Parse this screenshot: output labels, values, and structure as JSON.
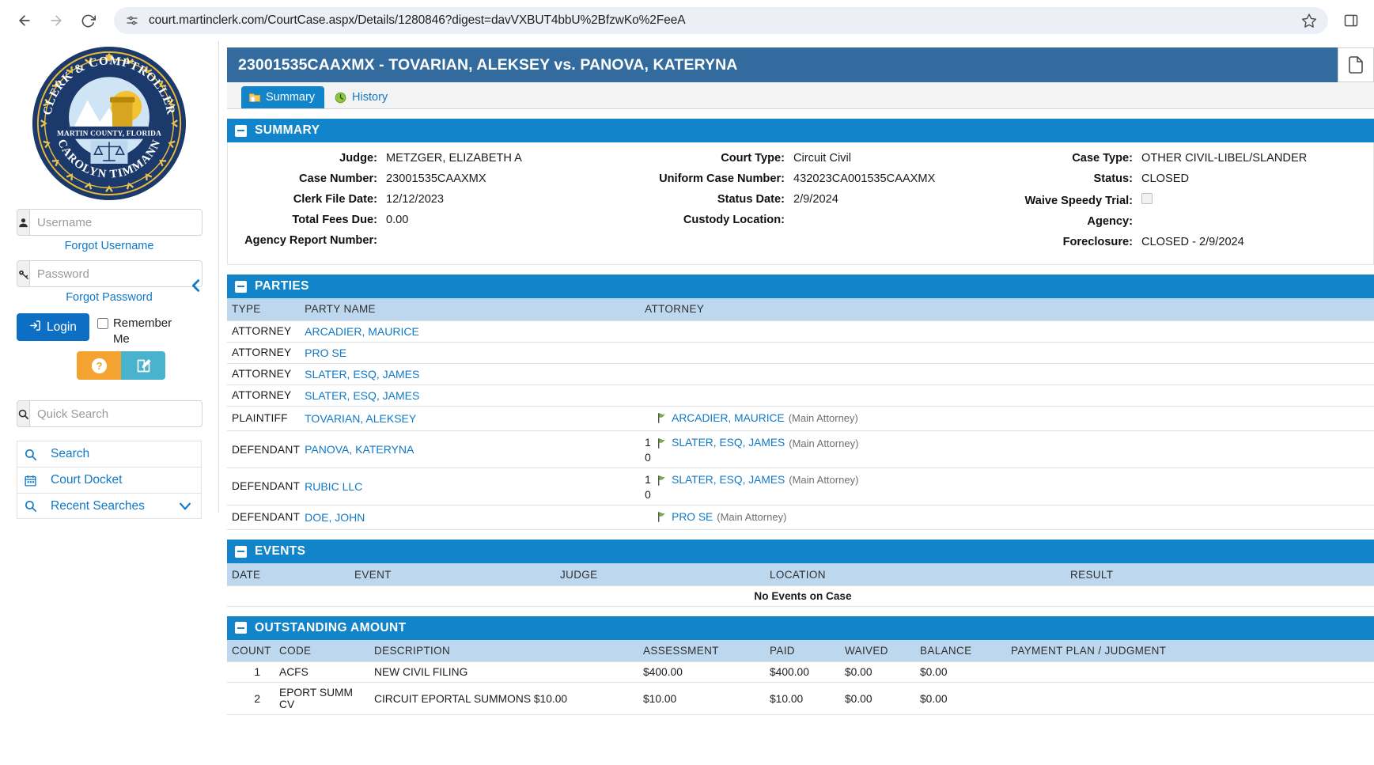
{
  "browser": {
    "url": "court.martinclerk.com/CourtCase.aspx/Details/1280846?digest=davVXBUT4bbU%2BfzwKo%2FeeA",
    "back_label": "Back",
    "forward_label": "Forward",
    "reload_label": "Reload",
    "bookmark_label": "Bookmark this tab",
    "sidepanel_label": "Side panel"
  },
  "sidebar": {
    "seal": {
      "top_text": "CLERK & COMPTROLLER",
      "middle_text": "MARTIN COUNTY, FLORIDA",
      "bottom_text": "CAROLYN TIMMANN"
    },
    "username": {
      "placeholder": "Username",
      "value": ""
    },
    "password": {
      "placeholder": "Password",
      "value": ""
    },
    "forgot_username": "Forgot Username",
    "forgot_password": "Forgot Password",
    "login_label": "Login",
    "remember_label": "Remember Me",
    "help_title": "Help",
    "register_title": "Register",
    "quick_search": {
      "placeholder": "Quick Search",
      "value": ""
    },
    "nav_items": [
      {
        "label": "Search",
        "icon": "search-icon"
      },
      {
        "label": "Court Docket",
        "icon": "calendar-icon"
      },
      {
        "label": "Recent Searches",
        "icon": "search-icon",
        "chevron": true
      }
    ]
  },
  "case": {
    "title": "23001535CAAXMX - TOVARIAN, ALEKSEY vs. PANOVA, KATERYNA",
    "tabs": [
      {
        "label": "Summary",
        "active": true,
        "icon": "folder-icon"
      },
      {
        "label": "History",
        "active": false,
        "icon": "history-icon"
      }
    ]
  },
  "summary": {
    "heading": "SUMMARY",
    "col1": [
      {
        "label": "Judge:",
        "value": "METZGER, ELIZABETH A"
      },
      {
        "label": "Case Number:",
        "value": "23001535CAAXMX"
      },
      {
        "label": "Clerk File Date:",
        "value": "12/12/2023"
      },
      {
        "label": "Total Fees Due:",
        "value": "0.00"
      },
      {
        "label": "Agency Report Number:",
        "value": ""
      }
    ],
    "col2": [
      {
        "label": "Court Type:",
        "value": "Circuit Civil"
      },
      {
        "label": "Uniform Case Number:",
        "value": "432023CA001535CAAXMX"
      },
      {
        "label": "Status Date:",
        "value": "2/9/2024"
      },
      {
        "label": "Custody Location:",
        "value": ""
      }
    ],
    "col3": [
      {
        "label": "Case Type:",
        "value": "OTHER CIVIL-LIBEL/SLANDER"
      },
      {
        "label": "Status:",
        "value": "CLOSED"
      },
      {
        "label": "Waive Speedy Trial:",
        "value": "",
        "checkbox": true
      },
      {
        "label": "Agency:",
        "value": ""
      },
      {
        "label": "Foreclosure:",
        "value": "CLOSED - 2/9/2024"
      }
    ]
  },
  "parties": {
    "heading": "PARTIES",
    "columns": [
      "TYPE",
      "PARTY NAME",
      "ATTORNEY"
    ],
    "rows": [
      {
        "type": "ATTORNEY",
        "name": "ARCADIER, MAURICE",
        "attorneys": []
      },
      {
        "type": "ATTORNEY",
        "name": "PRO SE",
        "attorneys": []
      },
      {
        "type": "ATTORNEY",
        "name": "SLATER, ESQ, JAMES",
        "attorneys": []
      },
      {
        "type": "ATTORNEY",
        "name": "SLATER, ESQ, JAMES",
        "attorneys": []
      },
      {
        "type": "PLAINTIFF",
        "name": "TOVARIAN, ALEKSEY",
        "attorneys": [
          {
            "num": "",
            "name": "ARCADIER, MAURICE",
            "role": "(Main Attorney)"
          }
        ]
      },
      {
        "type": "DEFENDANT",
        "name": "PANOVA, KATERYNA",
        "attorneys": [
          {
            "num": "1",
            "name": "SLATER, ESQ, JAMES",
            "role": "(Main Attorney)"
          }
        ],
        "extra": "0"
      },
      {
        "type": "DEFENDANT",
        "name": "RUBIC LLC",
        "attorneys": [
          {
            "num": "1",
            "name": "SLATER, ESQ, JAMES",
            "role": "(Main Attorney)"
          }
        ],
        "extra": "0"
      },
      {
        "type": "DEFENDANT",
        "name": "DOE, JOHN",
        "attorneys": [
          {
            "num": "",
            "name": "PRO SE",
            "role": "(Main Attorney)"
          }
        ]
      }
    ]
  },
  "events": {
    "heading": "EVENTS",
    "columns": [
      "DATE",
      "EVENT",
      "JUDGE",
      "LOCATION",
      "RESULT"
    ],
    "empty_message": "No Events on Case"
  },
  "outstanding": {
    "heading": "OUTSTANDING AMOUNT",
    "columns": [
      "COUNT",
      "CODE",
      "DESCRIPTION",
      "ASSESSMENT",
      "PAID",
      "WAIVED",
      "BALANCE",
      "PAYMENT PLAN / JUDGMENT"
    ],
    "rows": [
      {
        "count": "1",
        "code": "ACFS",
        "description": "NEW CIVIL FILING",
        "assessment": "$400.00",
        "paid": "$400.00",
        "waived": "$0.00",
        "balance": "$0.00",
        "plan": ""
      },
      {
        "count": "2",
        "code": "EPORT SUMM CV",
        "description": "CIRCUIT EPORTAL SUMMONS $10.00",
        "assessment": "$10.00",
        "paid": "$10.00",
        "waived": "$0.00",
        "balance": "$0.00",
        "plan": ""
      }
    ]
  },
  "colors": {
    "header_blue": "#336b9e",
    "panel_blue": "#1284c9",
    "table_header_blue": "#bdd7ee",
    "link_blue": "#1178c6",
    "help_orange": "#f5a330",
    "register_teal": "#49b2cc"
  }
}
